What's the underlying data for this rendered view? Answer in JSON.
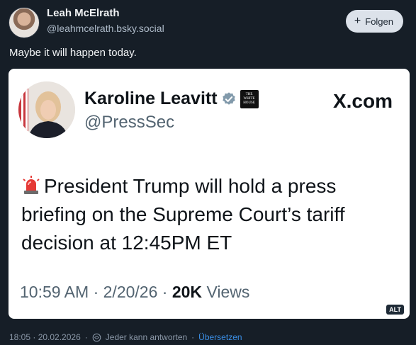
{
  "post": {
    "author_name": "Leah McElrath",
    "author_handle": "@leahmcelrath.bsky.social",
    "follow_label": "Folgen",
    "text": "Maybe it will happen today."
  },
  "embed": {
    "name": "Karoline Leavitt",
    "handle": "@PressSec",
    "source": "X.com",
    "text": "President Trump will hold a press briefing on the Supreme Court’s tariff decision at 12:45PM ET",
    "time": "10:59 AM",
    "date": "2/20/26",
    "views_count": "20K",
    "views_label": "Views",
    "badge_lines": [
      "THE",
      "WHITE",
      "HOUSE"
    ],
    "alt_label": "ALT"
  },
  "footer": {
    "timestamp": "18:05 · 20.02.2026",
    "reply_setting": "Jeder kann antworten",
    "translate_label": "Übersetzen"
  },
  "colors": {
    "background": "#161e27",
    "link": "#3b8fe6",
    "verified": "#829aab"
  },
  "icons": {
    "verified": "verified-badge-icon",
    "siren": "police-light-icon",
    "reply": "reply-setting-icon"
  }
}
